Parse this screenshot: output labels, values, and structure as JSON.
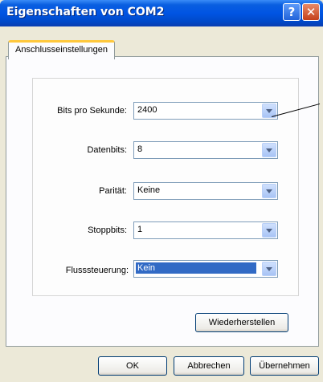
{
  "window": {
    "title": "Eigenschaften von COM2",
    "help_label": "?",
    "close_label": "✕"
  },
  "tabs": [
    {
      "label": "Anschlusseinstellungen",
      "active": true
    }
  ],
  "settings": [
    {
      "label": "Bits pro Sekunde:",
      "value": "2400"
    },
    {
      "label": "Datenbits:",
      "value": "8"
    },
    {
      "label": "Parität:",
      "value": "Keine"
    },
    {
      "label": "Stoppbits:",
      "value": "1"
    },
    {
      "label": "Flusssteuerung:",
      "value": "Kein",
      "selected": true
    }
  ],
  "buttons": {
    "restore": "Wiederherstellen",
    "ok": "OK",
    "cancel": "Abbrechen",
    "apply": "Übernehmen"
  },
  "icons": [
    "help-icon",
    "close-icon",
    "chevron-down-icon"
  ],
  "colors": {
    "titlebar": "#0054e3",
    "selection": "#316ac5",
    "tab_highlight": "#ffc83c"
  }
}
